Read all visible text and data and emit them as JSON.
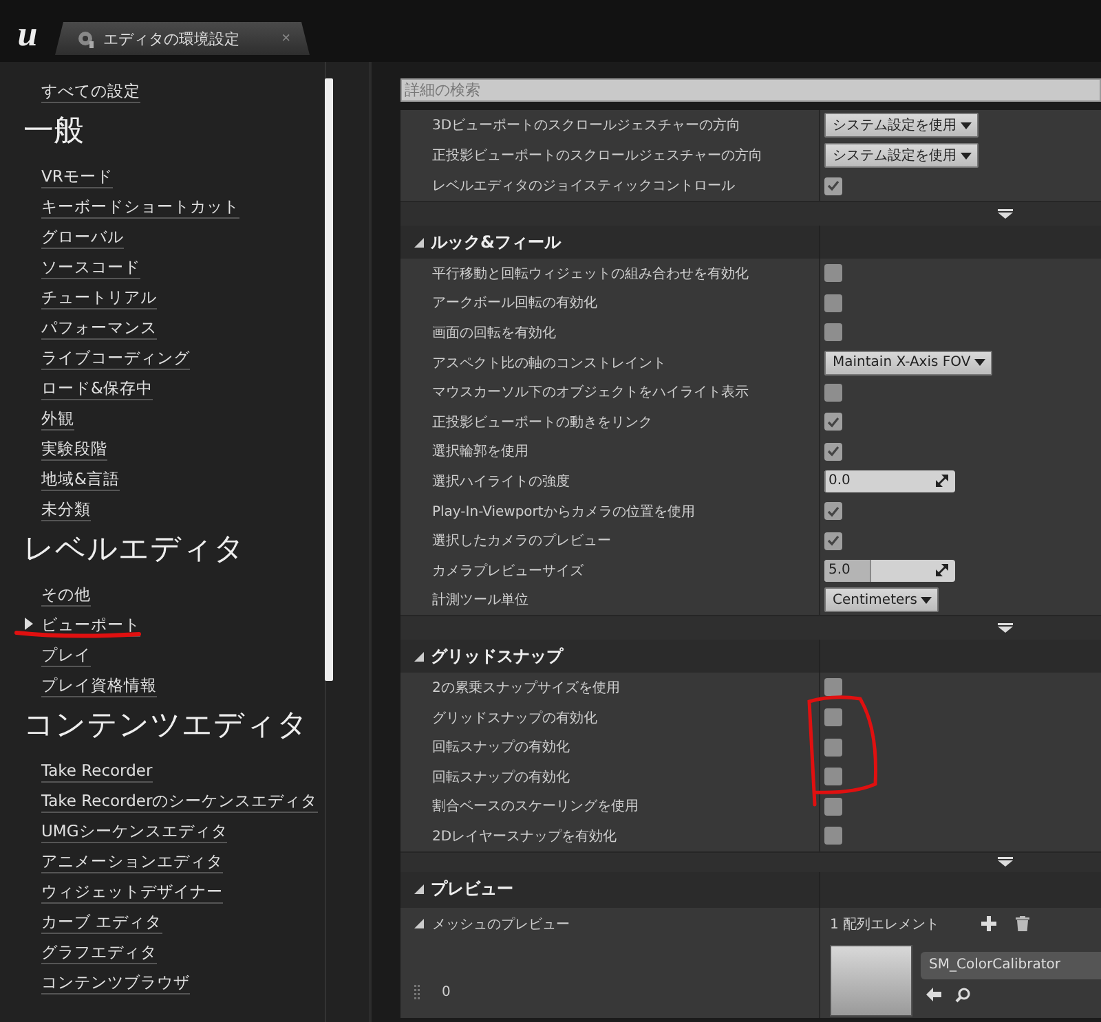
{
  "app_logo": "u",
  "tab": {
    "title": "エディタの環境設定",
    "close": "×"
  },
  "sidebar": {
    "all_settings": "すべての設定",
    "groups": [
      {
        "heading": "一般",
        "items": [
          {
            "label": "VRモード",
            "selected": false
          },
          {
            "label": "キーボードショートカット",
            "selected": false
          },
          {
            "label": "グローバル",
            "selected": false
          },
          {
            "label": "ソースコード",
            "selected": false
          },
          {
            "label": "チュートリアル",
            "selected": false
          },
          {
            "label": "パフォーマンス",
            "selected": false
          },
          {
            "label": "ライブコーディング",
            "selected": false
          },
          {
            "label": "ロード&保存中",
            "selected": false
          },
          {
            "label": "外観",
            "selected": false
          },
          {
            "label": "実験段階",
            "selected": false
          },
          {
            "label": "地域&言語",
            "selected": false
          },
          {
            "label": "未分類",
            "selected": false
          }
        ]
      },
      {
        "heading": "レベルエディタ",
        "items": [
          {
            "label": "その他",
            "selected": false
          },
          {
            "label": "ビューポート",
            "selected": true
          },
          {
            "label": "プレイ",
            "selected": false
          },
          {
            "label": "プレイ資格情報",
            "selected": false
          }
        ]
      },
      {
        "heading": "コンテンツエディタ",
        "items": [
          {
            "label": "Take Recorder",
            "selected": false
          },
          {
            "label": "Take Recorderのシーケンスエディタ",
            "selected": false
          },
          {
            "label": "UMGシーケンスエディタ",
            "selected": false
          },
          {
            "label": "アニメーションエディタ",
            "selected": false
          },
          {
            "label": "ウィジェットデザイナー",
            "selected": false
          },
          {
            "label": "カーブ エディタ",
            "selected": false
          },
          {
            "label": "グラフエディタ",
            "selected": false
          },
          {
            "label": "コンテンツブラウザ",
            "selected": false
          }
        ]
      }
    ]
  },
  "details": {
    "search": {
      "placeholder": "詳細の検索"
    },
    "sections": [
      {
        "rows": [
          {
            "label": "3Dビューポートのスクロールジェスチャーの方向",
            "kind": "dropdown",
            "value": "システム設定を使用"
          },
          {
            "label": "正投影ビューポートのスクロールジェスチャーの方向",
            "kind": "dropdown",
            "value": "システム設定を使用"
          },
          {
            "label": "レベルエディタのジョイスティックコントロール",
            "kind": "checkbox",
            "checked": true
          }
        ]
      },
      {
        "title": "ルック&フィール",
        "expanded": true,
        "rows": [
          {
            "label": "平行移動と回転ウィジェットの組み合わせを有効化",
            "kind": "checkbox",
            "checked": false
          },
          {
            "label": "アークボール回転の有効化",
            "kind": "checkbox",
            "checked": false
          },
          {
            "label": "画面の回転を有効化",
            "kind": "checkbox",
            "checked": false
          },
          {
            "label": "アスペクト比の軸のコンストレイント",
            "kind": "dropdown",
            "value": "Maintain X-Axis FOV"
          },
          {
            "label": "マウスカーソル下のオブジェクトをハイライト表示",
            "kind": "checkbox",
            "checked": false
          },
          {
            "label": "正投影ビューポートの動きをリンク",
            "kind": "checkbox",
            "checked": true
          },
          {
            "label": "選択輪郭を使用",
            "kind": "checkbox",
            "checked": true
          },
          {
            "label": "選択ハイライトの強度",
            "kind": "number",
            "value": "0.0",
            "level": 0
          },
          {
            "label": "Play-In-Viewportからカメラの位置を使用",
            "kind": "checkbox",
            "checked": true
          },
          {
            "label": "選択したカメラのプレビュー",
            "kind": "checkbox",
            "checked": true
          },
          {
            "label": "カメラプレビューサイズ",
            "kind": "number",
            "value": "5.0",
            "level": 0.35
          },
          {
            "label": "計測ツール単位",
            "kind": "dropdown",
            "value": "Centimeters"
          }
        ]
      },
      {
        "title": "グリッドスナップ",
        "expanded": true,
        "rows": [
          {
            "label": "2の累乗スナップサイズを使用",
            "kind": "checkbox",
            "checked": false
          },
          {
            "label": "グリッドスナップの有効化",
            "kind": "checkbox",
            "checked": false
          },
          {
            "label": "回転スナップの有効化",
            "kind": "checkbox",
            "checked": false
          },
          {
            "label": "回転スナップの有効化",
            "kind": "checkbox",
            "checked": false
          },
          {
            "label": "割合ベースのスケーリングを使用",
            "kind": "checkbox",
            "checked": false
          },
          {
            "label": "2Dレイヤースナップを有効化",
            "kind": "checkbox",
            "checked": false
          }
        ]
      },
      {
        "title": "プレビュー",
        "expanded": true,
        "array_row": {
          "label": "メッシュのプレビュー",
          "expanded": true,
          "count": "1 配列エレメント",
          "index": "0",
          "asset": "SM_ColorCalibrator"
        }
      }
    ]
  }
}
